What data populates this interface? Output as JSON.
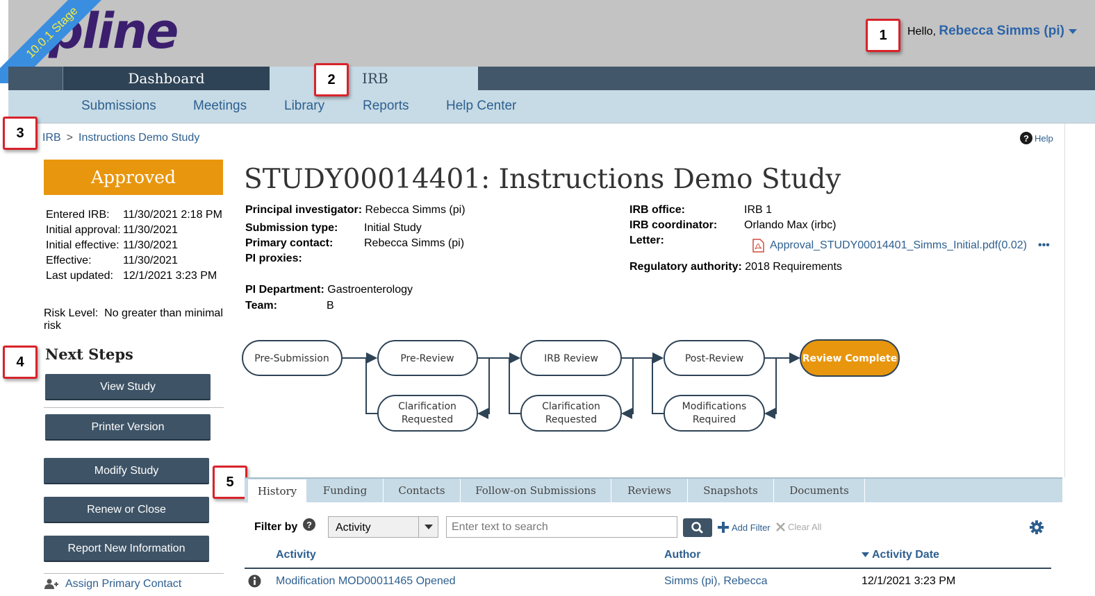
{
  "header": {
    "logo_text": "pline",
    "env_badge": "10.0.1 Stage",
    "greeting": "Hello,",
    "user_name": "Rebecca Simms (pi)"
  },
  "main_tabs": {
    "dashboard": "Dashboard",
    "irb": "IRB"
  },
  "subnav": {
    "submissions": "Submissions",
    "meetings": "Meetings",
    "library": "Library",
    "reports": "Reports",
    "help_center": "Help Center"
  },
  "callouts": {
    "c1": "1",
    "c2": "2",
    "c3": "3",
    "c4": "4",
    "c5": "5"
  },
  "breadcrumb": {
    "root": "IRB",
    "separator": ">",
    "current": "Instructions Demo Study"
  },
  "help_label": "Help",
  "sidebar": {
    "status": "Approved",
    "dates": [
      {
        "label": "Entered IRB:",
        "value": "11/30/2021 2:18 PM"
      },
      {
        "label": "Initial approval:",
        "value": "11/30/2021"
      },
      {
        "label": "Initial effective:",
        "value": "11/30/2021"
      },
      {
        "label": "Effective:",
        "value": "11/30/2021"
      },
      {
        "label": "Last updated:",
        "value": "12/1/2021 3:23 PM"
      }
    ],
    "risk_label": "Risk Level:",
    "risk_value": "No greater than minimal risk",
    "next_steps_title": "Next Steps",
    "buttons": {
      "view_study": "View Study",
      "printer_version": "Printer Version",
      "modify_study": "Modify Study",
      "renew_or_close": "Renew or Close",
      "report_new_info": "Report New Information"
    },
    "assign_primary_contact": "Assign Primary Contact"
  },
  "study": {
    "title": "STUDY00014401: Instructions Demo Study",
    "pi_label": "Principal investigator:",
    "pi_value": "Rebecca Simms (pi)",
    "submission_type_label": "Submission type:",
    "submission_type_value": "Initial Study",
    "primary_contact_label": "Primary contact:",
    "primary_contact_value": "Rebecca Simms (pi)",
    "pi_proxies_label": "PI proxies:",
    "pi_department_label": "PI Department:",
    "pi_department_value": "Gastroenterology",
    "team_label": "Team:",
    "team_value": "B",
    "irb_office_label": "IRB office:",
    "irb_office_value": "IRB 1",
    "irb_coordinator_label": "IRB coordinator:",
    "irb_coordinator_value": "Orlando Max (irbc)",
    "letter_label": "Letter:",
    "letter_value": "Approval_STUDY00014401_Simms_Initial.pdf(0.02)",
    "more_actions": "•••",
    "regulatory_label": "Regulatory authority:",
    "regulatory_value": "2018 Requirements"
  },
  "workflow": {
    "states": [
      "Pre-Submission",
      "Pre-Review",
      "IRB Review",
      "Post-Review",
      "Review Complete"
    ],
    "sub_states": [
      [
        "Clarification",
        "Requested"
      ],
      [
        "Clarification",
        "Requested"
      ],
      [
        "Modifications",
        "Required"
      ]
    ],
    "current_state": "Review Complete",
    "active_color": "#e8960e"
  },
  "detail_tabs": [
    "History",
    "Funding",
    "Contacts",
    "Follow-on Submissions",
    "Reviews",
    "Snapshots",
    "Documents"
  ],
  "history": {
    "filter_label": "Filter by",
    "filter_select_value": "Activity",
    "search_placeholder": "Enter text to search",
    "add_filter": "Add Filter",
    "clear_all": "Clear All",
    "columns": {
      "activity": "Activity",
      "author": "Author",
      "date": "Activity Date"
    },
    "rows": [
      {
        "activity": "Modification MOD00011465 Opened",
        "author": "Simms (pi), Rebecca",
        "date": "12/1/2021 3:23 PM"
      }
    ]
  }
}
